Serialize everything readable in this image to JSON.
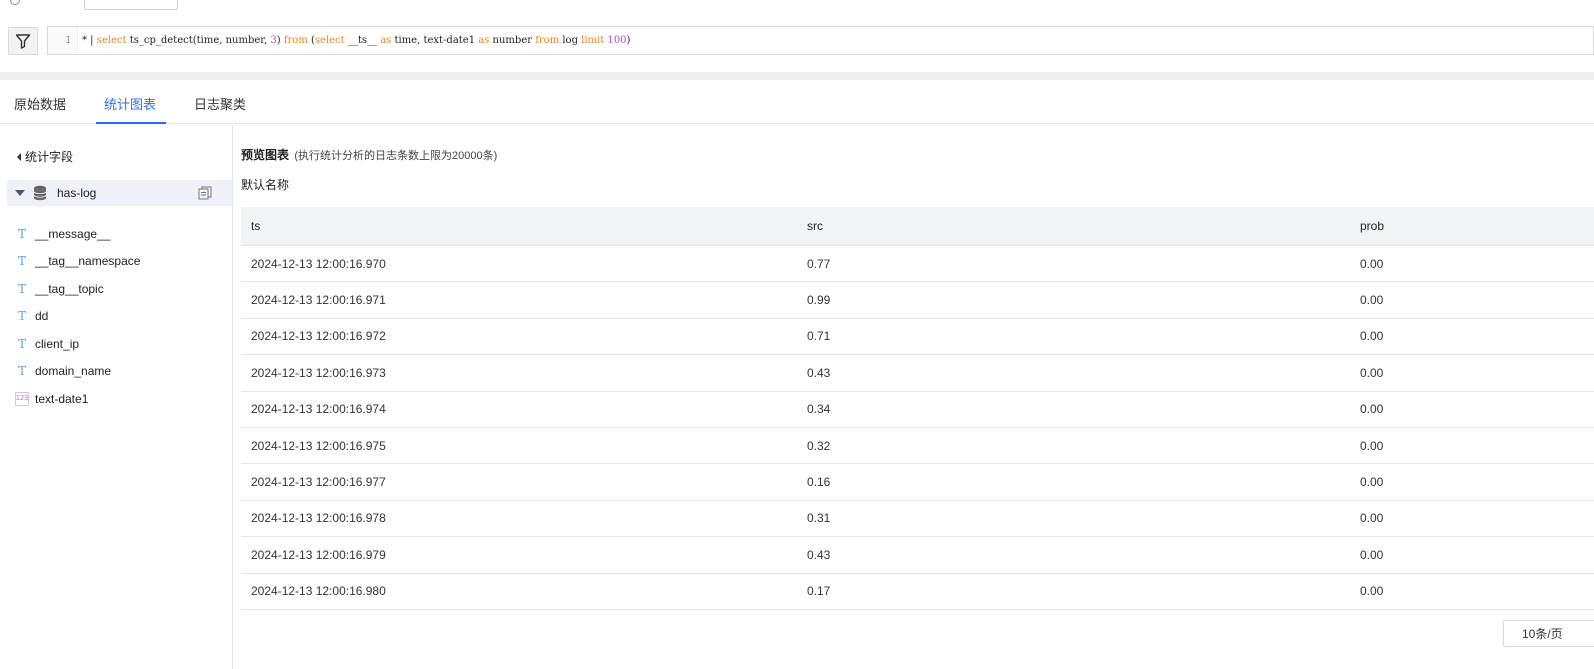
{
  "query": {
    "line_number": "1",
    "tokens": [
      {
        "text": "* | ",
        "kind": "plain"
      },
      {
        "text": "select",
        "kind": "keyword"
      },
      {
        "text": " ts_cp_detect(time, number, ",
        "kind": "plain"
      },
      {
        "text": "3",
        "kind": "number"
      },
      {
        "text": ") ",
        "kind": "plain"
      },
      {
        "text": "from",
        "kind": "keyword"
      },
      {
        "text": " (",
        "kind": "plain"
      },
      {
        "text": "select",
        "kind": "keyword"
      },
      {
        "text": " __ts__ ",
        "kind": "plain"
      },
      {
        "text": "as",
        "kind": "keyword"
      },
      {
        "text": " time, text-date1 ",
        "kind": "plain"
      },
      {
        "text": "as",
        "kind": "keyword"
      },
      {
        "text": " number ",
        "kind": "plain"
      },
      {
        "text": "from",
        "kind": "keyword"
      },
      {
        "text": " log ",
        "kind": "plain"
      },
      {
        "text": "limit",
        "kind": "keyword"
      },
      {
        "text": " ",
        "kind": "plain"
      },
      {
        "text": "100",
        "kind": "number"
      },
      {
        "text": ")",
        "kind": "plain"
      }
    ]
  },
  "tabs": [
    {
      "label": "原始数据",
      "active": false
    },
    {
      "label": "统计图表",
      "active": true
    },
    {
      "label": "日志聚类",
      "active": false
    }
  ],
  "sidebar": {
    "title": "统计字段",
    "store_name": "has-log",
    "fields": [
      {
        "name": "__message__",
        "type": "text"
      },
      {
        "name": "__tag__namespace",
        "type": "text"
      },
      {
        "name": "__tag__topic",
        "type": "text"
      },
      {
        "name": "dd",
        "type": "text"
      },
      {
        "name": "client_ip",
        "type": "text"
      },
      {
        "name": "domain_name",
        "type": "text"
      },
      {
        "name": "text-date1",
        "type": "number"
      }
    ]
  },
  "main": {
    "preview_title": "预览图表",
    "preview_note": "(执行统计分析的日志条数上限为20000条)",
    "chart_name": "默认名称",
    "columns": [
      "ts",
      "src",
      "prob"
    ],
    "rows": [
      [
        "2024-12-13 12:00:16.970",
        "0.77",
        "0.00"
      ],
      [
        "2024-12-13 12:00:16.971",
        "0.99",
        "0.00"
      ],
      [
        "2024-12-13 12:00:16.972",
        "0.71",
        "0.00"
      ],
      [
        "2024-12-13 12:00:16.973",
        "0.43",
        "0.00"
      ],
      [
        "2024-12-13 12:00:16.974",
        "0.34",
        "0.00"
      ],
      [
        "2024-12-13 12:00:16.975",
        "0.32",
        "0.00"
      ],
      [
        "2024-12-13 12:00:16.977",
        "0.16",
        "0.00"
      ],
      [
        "2024-12-13 12:00:16.978",
        "0.31",
        "0.00"
      ],
      [
        "2024-12-13 12:00:16.979",
        "0.43",
        "0.00"
      ],
      [
        "2024-12-13 12:00:16.980",
        "0.17",
        "0.00"
      ]
    ],
    "page_size_label": "10条/页"
  },
  "colors": {
    "accent": "#2b6ff5",
    "keyword": "#e8861b",
    "number": "#b14ac9",
    "text_icon": "#5ba4e5",
    "number_icon": "#b07cd8"
  },
  "icons": {
    "filter": "filter-icon",
    "database": "database-icon",
    "copy": "copy-icon",
    "text_type": "text-type-icon",
    "number_type": "number-type-icon"
  }
}
